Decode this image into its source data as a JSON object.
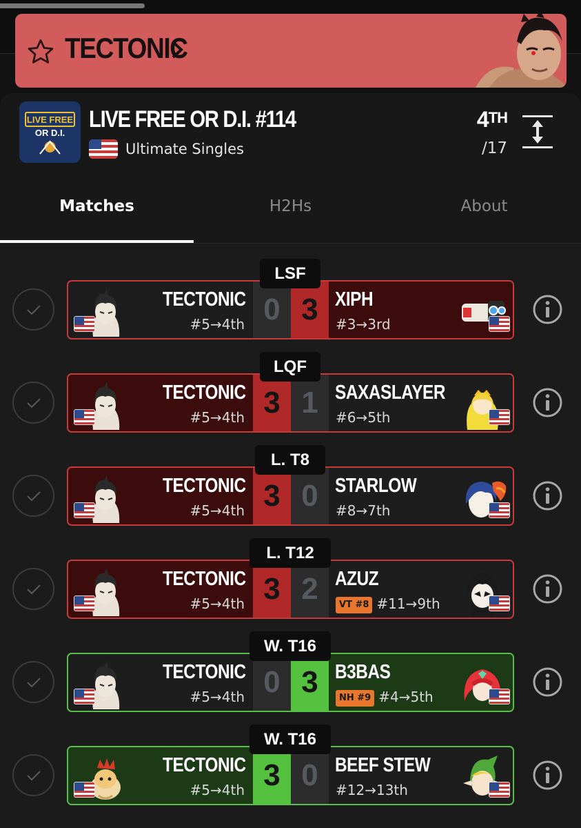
{
  "banner": {
    "player": "TECTONIC",
    "background": "#d25c5c",
    "icons": [
      "star-outline-icon",
      "chevron-right-icon"
    ]
  },
  "tournament": {
    "name": "LIVE FREE OR D.I. #114",
    "logo_text_top": "LIVE FREE",
    "logo_text_bottom": "OR D.I.",
    "event": "Ultimate Singles",
    "flag": "us-flag-icon",
    "placing_number": "4",
    "placing_suffix": "TH",
    "entrants": "/17"
  },
  "tabs": [
    {
      "label": "Matches",
      "active": true
    },
    {
      "label": "H2Hs",
      "active": false
    },
    {
      "label": "About",
      "active": false
    }
  ],
  "colors": {
    "win_border": "#58c049",
    "loss_border": "#c83a3a",
    "win_score": "#55c23f",
    "loss_score": "#b02828"
  },
  "matches": [
    {
      "round": "LSF",
      "result": "loss",
      "left": {
        "name": "TECTONIC",
        "seed": "#5→4th",
        "score": "0",
        "character": "kazuya"
      },
      "right": {
        "name": "XIPH",
        "seed": "#3→3rd",
        "score": "3",
        "tag": "",
        "character": "rob"
      }
    },
    {
      "round": "LQF",
      "result": "win",
      "left": {
        "name": "TECTONIC",
        "seed": "#5→4th",
        "score": "3",
        "character": "kazuya"
      },
      "right": {
        "name": "SAXASLAYER",
        "seed": "#6→5th",
        "score": "1",
        "tag": "",
        "character": "peach"
      }
    },
    {
      "round": "L. T8",
      "result": "win",
      "left": {
        "name": "TECTONIC",
        "seed": "#5→4th",
        "score": "3",
        "character": "kazuya"
      },
      "right": {
        "name": "STARLOW",
        "seed": "#8→7th",
        "score": "0",
        "tag": "",
        "character": "ike"
      }
    },
    {
      "round": "L. T12",
      "result": "win",
      "left": {
        "name": "TECTONIC",
        "seed": "#5→4th",
        "score": "3",
        "character": "kazuya"
      },
      "right": {
        "name": "AZUZ",
        "seed": "#11→9th",
        "score": "2",
        "tag": "VT #8",
        "character": "joker"
      }
    },
    {
      "round": "W. T16",
      "result": "loss",
      "left": {
        "name": "TECTONIC",
        "seed": "#5→4th",
        "score": "0",
        "character": "kazuya"
      },
      "right": {
        "name": "B3BAS",
        "seed": "#4→5th",
        "score": "3",
        "tag": "NH #9",
        "character": "pyra"
      }
    },
    {
      "round": "W. T16",
      "result": "win",
      "left": {
        "name": "TECTONIC",
        "seed": "#5→4th",
        "score": "3",
        "character": "bowser-jr"
      },
      "right": {
        "name": "BEEF STEW",
        "seed": "#12→13th",
        "score": "0",
        "tag": "",
        "character": "young-link"
      }
    }
  ]
}
